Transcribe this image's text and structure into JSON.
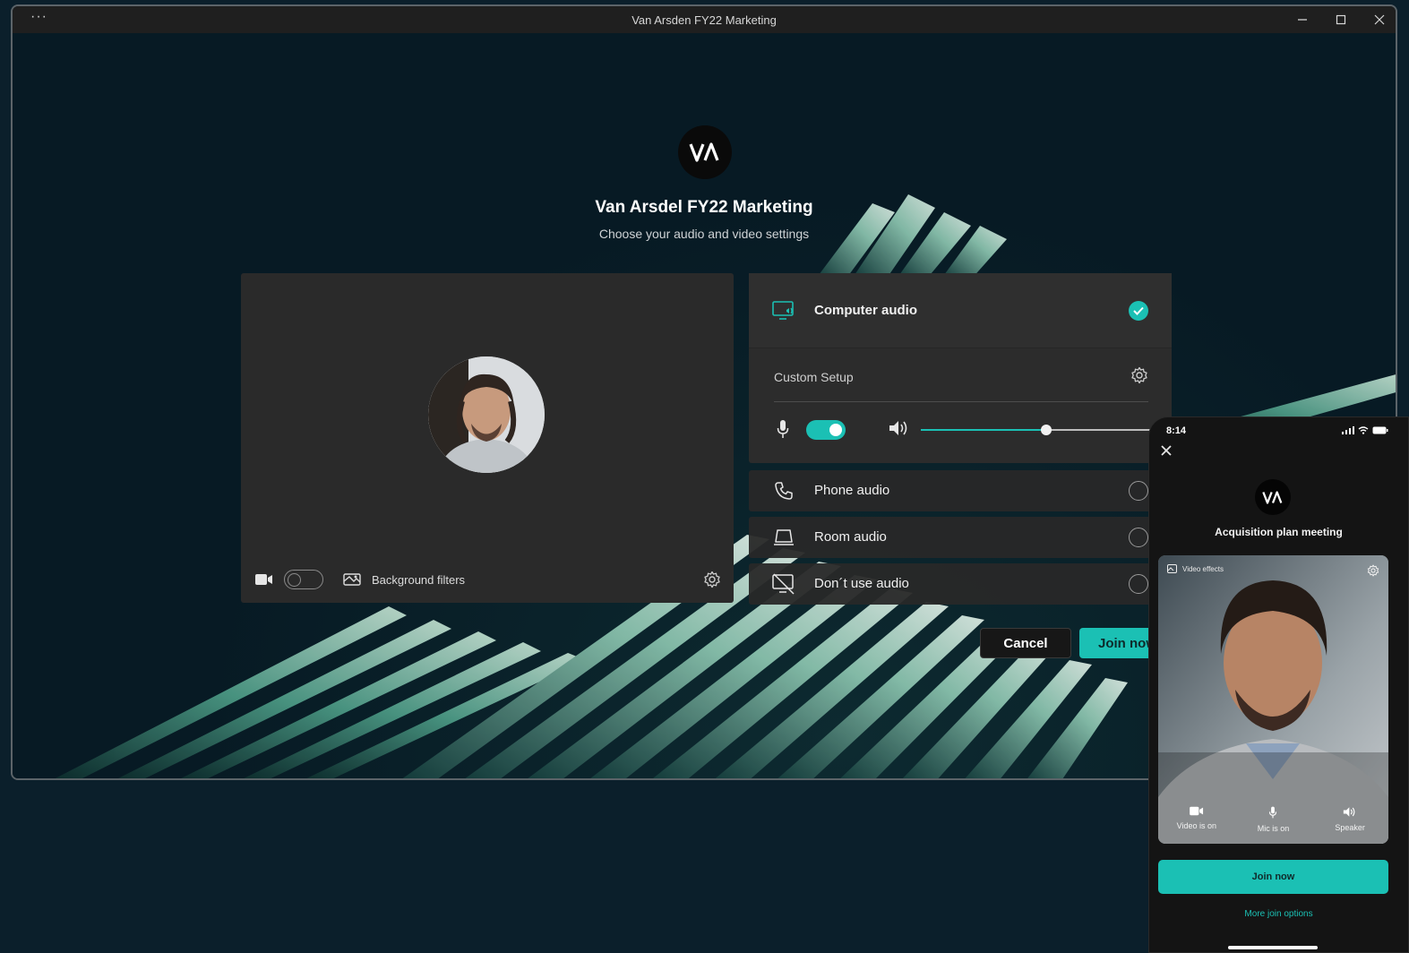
{
  "window": {
    "title": "Van Arsden FY22 Marketing",
    "menu_dots": "···"
  },
  "meeting": {
    "logo_text": "VA",
    "title": "Van Arsdel FY22 Marketing",
    "subtitle": "Choose your audio and video settings"
  },
  "video": {
    "camera_on": false,
    "background_filters_label": "Background filters"
  },
  "audio": {
    "computer_audio_label": "Computer audio",
    "computer_audio_selected": true,
    "custom_setup_label": "Custom Setup",
    "mic_on": true,
    "speaker_volume": 0.5,
    "options": [
      {
        "label": "Phone audio",
        "icon": "phone-icon",
        "selected": false
      },
      {
        "label": "Room audio",
        "icon": "room-audio-icon",
        "selected": false
      },
      {
        "label": "Don´t use audio",
        "icon": "no-audio-icon",
        "selected": false
      }
    ]
  },
  "actions": {
    "cancel_label": "Cancel",
    "join_label": "Join now"
  },
  "phone": {
    "time": "8:14",
    "logo_text": "VA",
    "meeting_title": "Acquisition plan meeting",
    "video_effects_label": "Video effects",
    "controls": [
      {
        "label": "Video is on",
        "icon": "video-icon"
      },
      {
        "label": "Mic is on",
        "icon": "mic-icon"
      },
      {
        "label": "Speaker",
        "icon": "speaker-icon"
      }
    ],
    "join_label": "Join now",
    "more_options_label": "More join options"
  },
  "colors": {
    "accent": "#1bc0b4",
    "panel": "#2a2a2a",
    "background": "#071a24"
  }
}
